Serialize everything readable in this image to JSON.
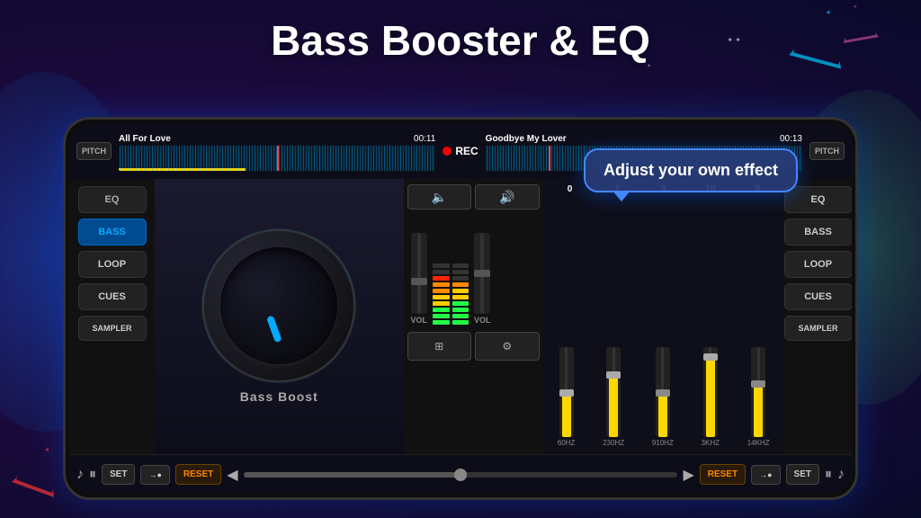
{
  "title": "Bass Booster & EQ",
  "background": {
    "color_start": "#2a0a5a",
    "color_end": "#0a0a2a"
  },
  "phone": {
    "waveform": {
      "left_track": "All For Love",
      "left_time": "00:11",
      "right_track": "Goodbye My Lover",
      "right_time": "00:13",
      "rec_label": "REC",
      "pitch_label": "PITCH"
    },
    "left_panel": {
      "buttons": [
        "EQ",
        "BASS",
        "LOOP",
        "CUES",
        "SAMPLER"
      ],
      "active": "BASS"
    },
    "right_panel": {
      "buttons": [
        "EQ",
        "BASS",
        "LOOP",
        "CUES",
        "SAMPLER"
      ]
    },
    "dj": {
      "knob_label": "Bass Boost"
    },
    "eq": {
      "values": [
        "0",
        "7",
        "0",
        "10",
        "0"
      ],
      "freqs": [
        "60HZ",
        "230HZ",
        "910HZ",
        "3KHZ",
        "14KHZ"
      ],
      "thumb_positions": [
        50,
        30,
        50,
        10,
        40
      ]
    },
    "transport": {
      "left_music_icon": "♪",
      "pause_icon": "⏸",
      "set_label": "SET",
      "arrow_dot": "→●",
      "reset_label": "RESET",
      "arrow_left": "◀",
      "arrow_right": "▶",
      "right_reset": "RESET",
      "right_arrow_dot": "→●",
      "right_set": "SET",
      "right_pause": "⏸",
      "right_music": "♪"
    },
    "tooltip": {
      "text": "Adjust your own effect"
    },
    "mixer": {
      "vol_left": "VOL",
      "vol_right": "VOL"
    }
  }
}
